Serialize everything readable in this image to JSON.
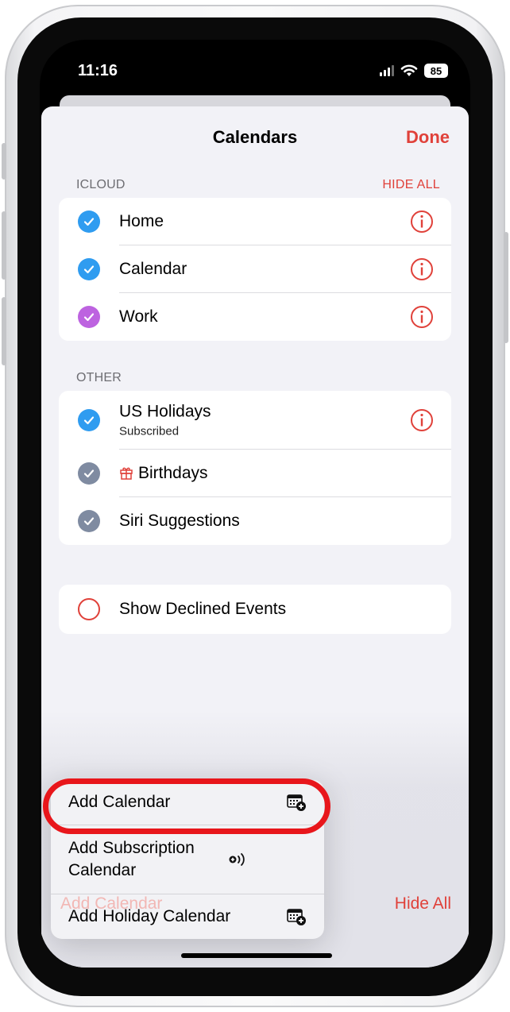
{
  "status_bar": {
    "time": "11:16",
    "battery": "85"
  },
  "nav": {
    "title": "Calendars",
    "done_label": "Done"
  },
  "icloud": {
    "label": "ICLOUD",
    "hide_all": "HIDE ALL",
    "items": [
      {
        "label": "Home",
        "color": "#2f9cf0",
        "checked": true
      },
      {
        "label": "Calendar",
        "color": "#2f9cf0",
        "checked": true
      },
      {
        "label": "Work",
        "color": "#bd63e0",
        "checked": true
      }
    ]
  },
  "other": {
    "label": "OTHER",
    "items": [
      {
        "label": "US Holidays",
        "sublabel": "Subscribed",
        "color": "#2f9cf0",
        "checked": true
      },
      {
        "label": "Birthdays",
        "color": "#7f8ba1",
        "checked": true
      },
      {
        "label": "Siri Suggestions",
        "color": "#7f8ba1",
        "checked": true
      }
    ]
  },
  "declined": {
    "label": "Show Declined Events",
    "checked": false
  },
  "menu": {
    "items": [
      {
        "label": "Add Calendar",
        "icon": "calendar-plus-icon"
      },
      {
        "label": "Add Subscription Calendar",
        "icon": "subscription-broadcast-icon"
      },
      {
        "label": "Add Holiday Calendar",
        "icon": "calendar-plus-icon"
      }
    ]
  },
  "toolbar": {
    "add_calendar": "Add Calendar",
    "hide_all": "Hide All"
  },
  "colors": {
    "accent": "#e0413a",
    "highlight_ring": "#e8161b"
  }
}
